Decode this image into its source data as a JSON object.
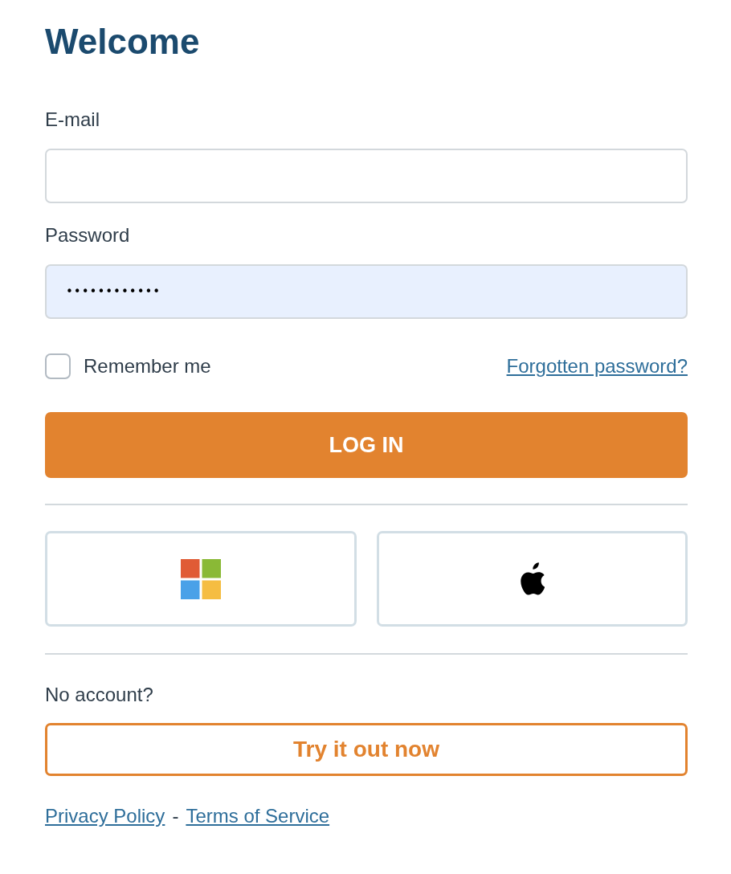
{
  "title": "Welcome",
  "fields": [
    {
      "label": "E-mail",
      "kind": "email",
      "autofilled": false
    },
    {
      "label": "Password",
      "kind": "password",
      "value": "••••••••••••",
      "autofilled": true
    }
  ],
  "remember": {
    "label": "Remember me",
    "checked": false
  },
  "forgot_link": "Forgotten password?",
  "login_button": "LOG IN",
  "social_buttons": [
    {
      "kind": "squares"
    },
    {
      "kind": "apple"
    }
  ],
  "signup": {
    "prompt": "No account?",
    "button": "Try it out now"
  },
  "footer": {
    "links": [
      "Privacy Policy",
      "Terms of Service"
    ],
    "separator": "-"
  }
}
